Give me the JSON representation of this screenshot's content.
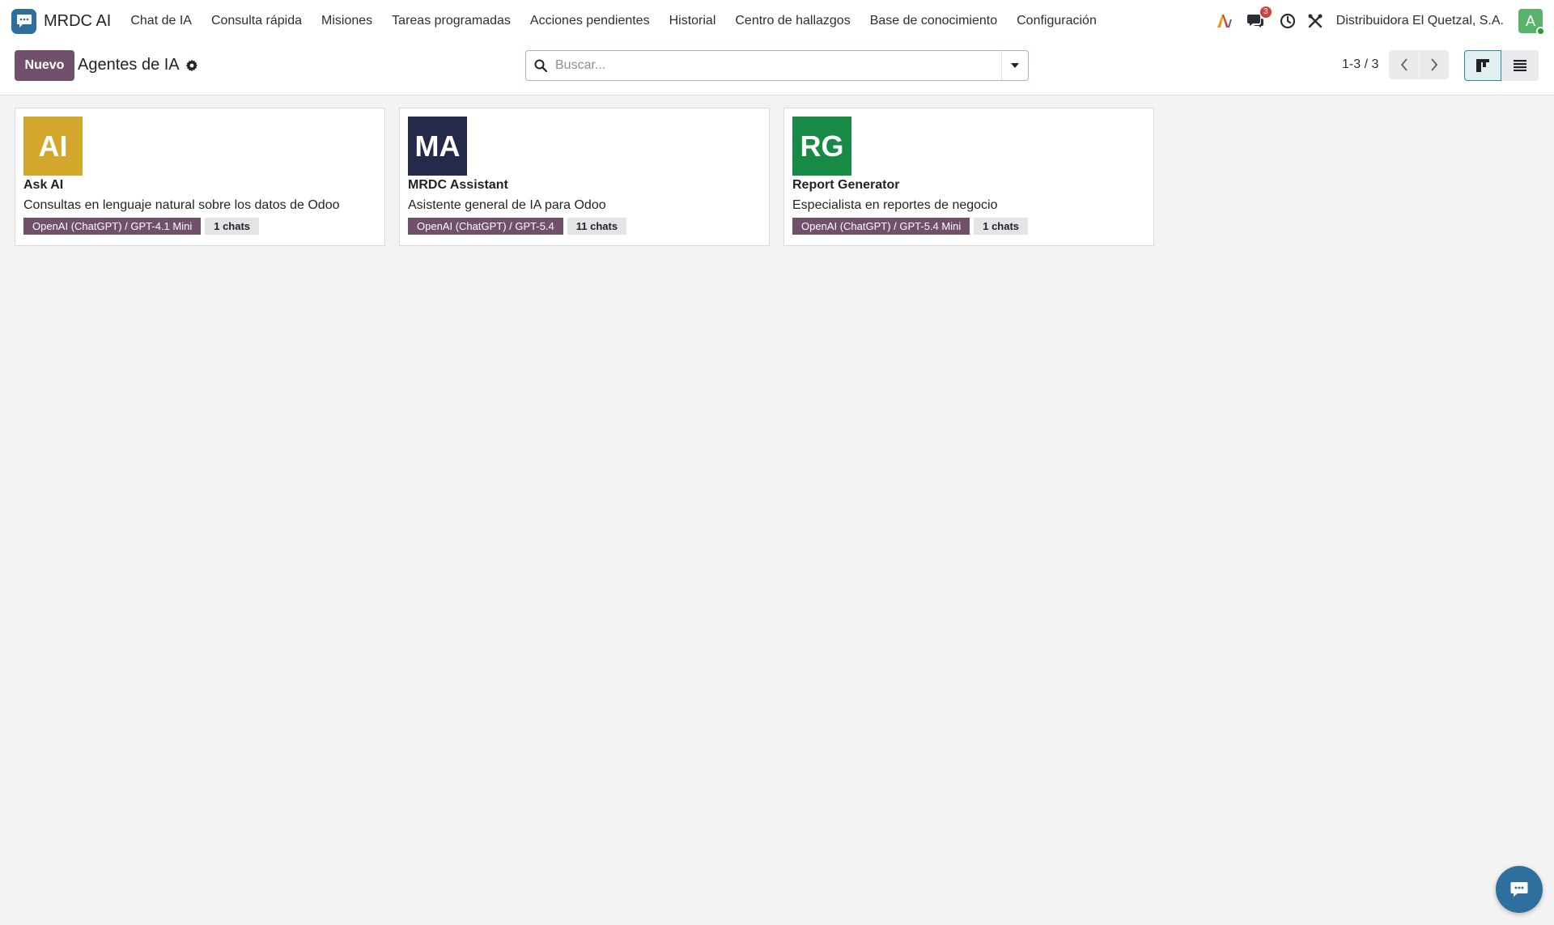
{
  "app": {
    "name": "MRDC AI"
  },
  "menu": [
    {
      "label": "Chat de IA"
    },
    {
      "label": "Consulta rápida"
    },
    {
      "label": "Misiones"
    },
    {
      "label": "Tareas programadas"
    },
    {
      "label": "Acciones pendientes"
    },
    {
      "label": "Historial"
    },
    {
      "label": "Centro de hallazgos"
    },
    {
      "label": "Base de conocimiento"
    },
    {
      "label": "Configuración"
    }
  ],
  "systray": {
    "messages_count": "3",
    "company": "Distribuidora El Quetzal, S.A.",
    "avatar_initial": "A",
    "colors": {
      "avatar": "#59b36b",
      "online": "#1f9d3a",
      "badge": "#d23f3a"
    }
  },
  "control": {
    "new_label": "Nuevo",
    "breadcrumb": "Agentes de IA",
    "search_placeholder": "Buscar...",
    "pager": "1-3 / 3"
  },
  "cards": [
    {
      "initials": "AI",
      "color": "#d3a62c",
      "name": "Ask AI",
      "description": "Consultas en lenguaje natural sobre los datos de Odoo",
      "model": "OpenAI (ChatGPT) / GPT-4.1 Mini",
      "chats": "1 chats"
    },
    {
      "initials": "MA",
      "color": "#252a4a",
      "name": "MRDC Assistant",
      "description": "Asistente general de IA para Odoo",
      "model": "OpenAI (ChatGPT) / GPT-5.4",
      "chats": "11 chats"
    },
    {
      "initials": "RG",
      "color": "#178a45",
      "name": "Report Generator",
      "description": "Especialista en reportes de negocio",
      "model": "OpenAI (ChatGPT) / GPT-5.4 Mini",
      "chats": "1 chats"
    }
  ],
  "colors": {
    "primary": "#71506b",
    "brand": "#2e6f9e",
    "accent": "#2f8b97"
  },
  "icons": [
    "app-logo-icon",
    "ai-icon",
    "chat-icon",
    "clock-icon",
    "tools-icon",
    "gear-icon",
    "search-icon",
    "caret-down-icon",
    "chevron-left-icon",
    "chevron-right-icon",
    "kanban-view-icon",
    "list-view-icon",
    "chat-bubble-icon"
  ]
}
